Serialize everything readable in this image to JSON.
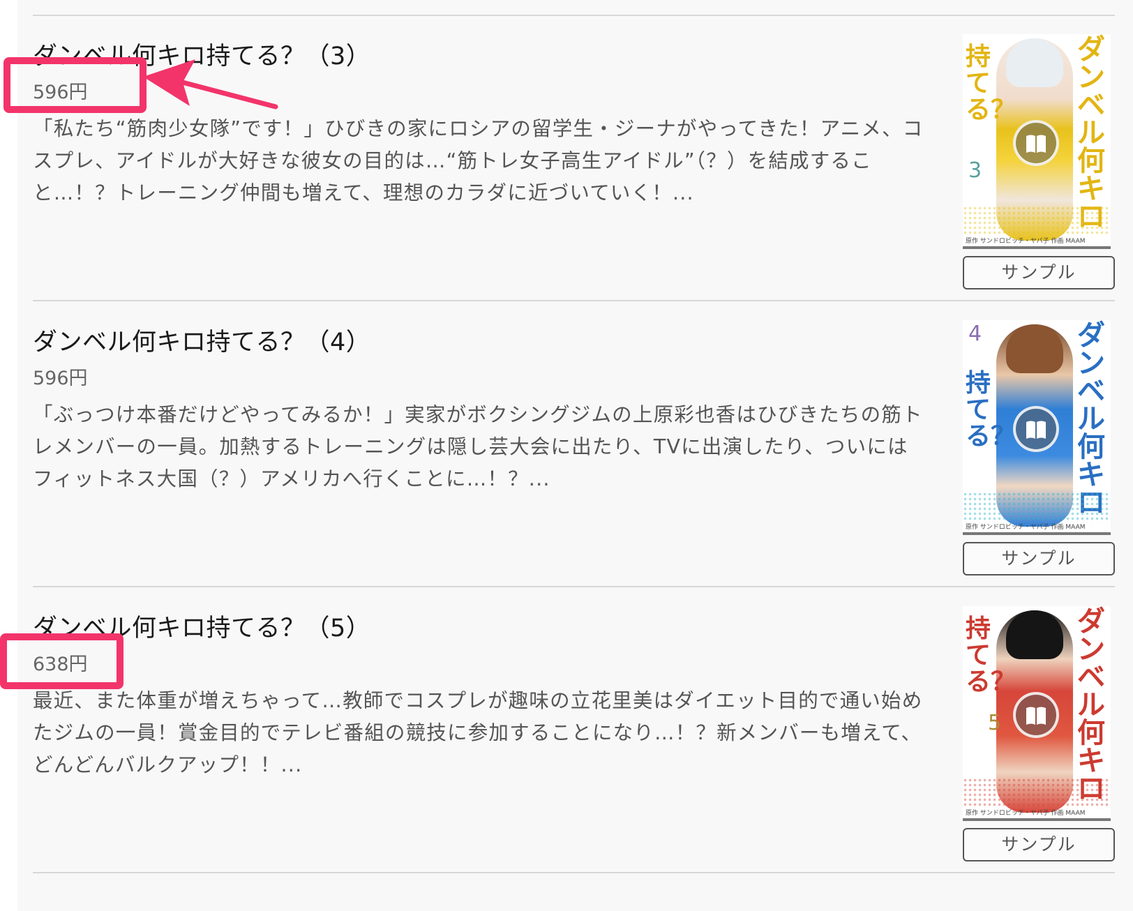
{
  "items": [
    {
      "title": "ダンベル何キロ持てる？（3）",
      "price": "596円",
      "description": "「私たち“筋肉少女隊”です！」ひびきの家にロシアの留学生・ジーナがやってきた！アニメ、コスプレ、アイドルが大好きな彼女の目的は…“筋トレ女子高生アイドル”（？）を結成すること…！？トレーニング仲間も増えて、理想のカラダに近づいていく！...",
      "cover": {
        "title_left": "持てる？",
        "title_right": "ダンベル何キロ",
        "volume": "3",
        "credit": "原作 サンドロビッチ・ヤバ子  作画 MAAM",
        "accent": "#e8c21c",
        "title_color": "#e3b512"
      },
      "sample_label": "サンプル"
    },
    {
      "title": "ダンベル何キロ持てる？（4）",
      "price": "596円",
      "description": "「ぶっつけ本番だけどやってみるか！」実家がボクシングジムの上原彩也香はひびきたちの筋トレメンバーの一員。加熱するトレーニングは隠し芸大会に出たり、TVに出演したり、ついにはフィットネス大国（？）アメリカへ行くことに…！？...",
      "cover": {
        "title_left": "持てる？",
        "title_right": "ダンベル何キロ",
        "volume": "4",
        "credit": "原作 サンドロビッチ・ヤバ子  作画 MAAM",
        "accent": "#2f7fd6",
        "title_color": "#2a6fc2"
      },
      "sample_label": "サンプル"
    },
    {
      "title": "ダンベル何キロ持てる？（5）",
      "price": "638円",
      "description": "最近、また体重が増えちゃって…教師でコスプレが趣味の立花里美はダイエット目的で通い始めたジムの一員！賞金目的でテレビ番組の競技に参加することになり…！？新メンバーも増えて、どんどんバルクアップ！！...",
      "cover": {
        "title_left": "持てる？",
        "title_right": "ダンベル何キロ",
        "volume": "5",
        "credit": "原作 サンドロビッチ・ヤバ子  作画 MAAM",
        "accent": "#d6463a",
        "title_color": "#cc3a30"
      },
      "sample_label": "サンプル"
    }
  ],
  "annotations": {
    "highlight_color": "#f2346a",
    "highlighted_prices": [
      "596円",
      "638円"
    ]
  }
}
